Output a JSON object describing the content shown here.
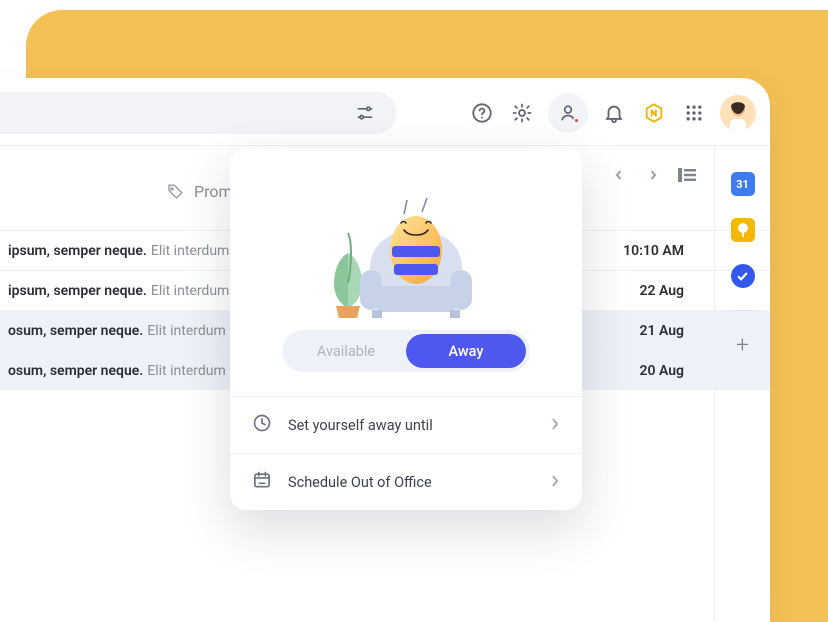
{
  "category": {
    "label": "Promo"
  },
  "rows": [
    {
      "bold": "ipsum, semper neque.",
      "rest": "Elit interdum",
      "time": "10:10 AM",
      "selected": false
    },
    {
      "bold": "ipsum, semper neque.",
      "rest": "Elit interdum",
      "time": "22 Aug",
      "selected": false
    },
    {
      "bold": "osum, semper neque.",
      "rest": "Elit interdum",
      "time": "21 Aug",
      "selected": true
    },
    {
      "bold": "osum, semper neque.",
      "rest": "Elit interdum",
      "time": "20 Aug",
      "selected": true
    }
  ],
  "popover": {
    "segment": {
      "available": "Available",
      "away": "Away"
    },
    "option1": "Set yourself away until",
    "option2": "Schedule Out of Office"
  },
  "rail": {
    "calendar_day": "31"
  }
}
